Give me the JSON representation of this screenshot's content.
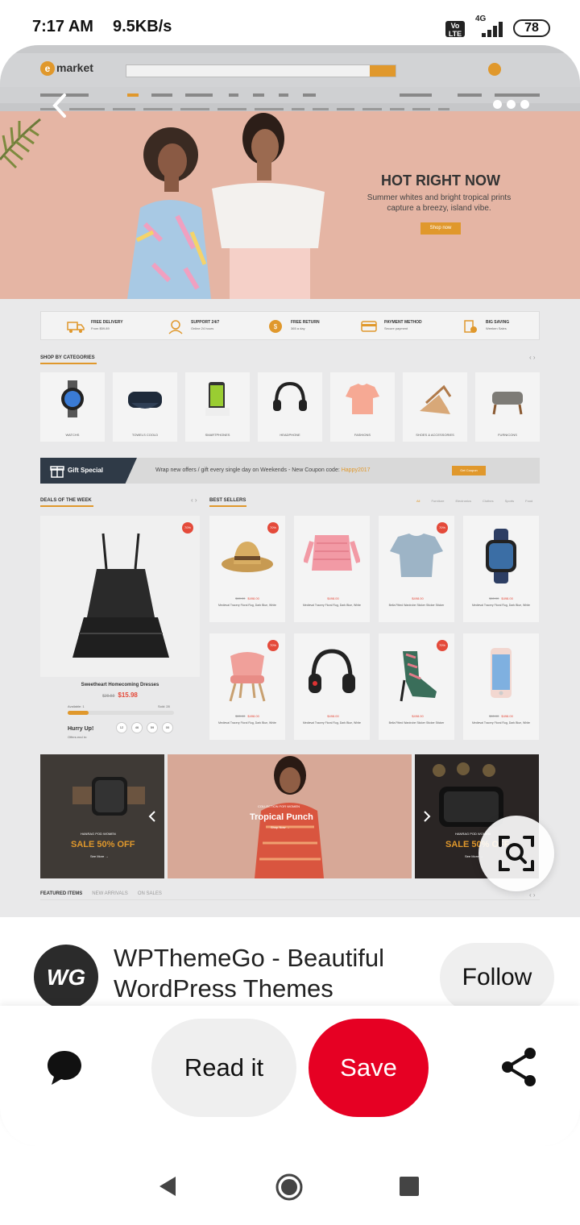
{
  "status_bar": {
    "time": "7:17 AM",
    "speed": "9.5KB/s",
    "volte": "Vo LTE",
    "network": "4G",
    "battery": "78"
  },
  "pin_image": {
    "site": {
      "logo": "market",
      "search_placeholder": "All Categories",
      "hero": {
        "title": "HOT RIGHT NOW",
        "subtitle": "Summer whites and bright tropical prints capture a breezy, island vibe.",
        "button": "Shop now"
      },
      "features": [
        {
          "title": "FREE DELIVERY",
          "sub": "From $59.89",
          "icon": "truck-icon"
        },
        {
          "title": "SUPPORT 24/7",
          "sub": "Online 24 hours",
          "icon": "support-icon"
        },
        {
          "title": "FREE RETURN",
          "sub": "365 a day",
          "icon": "return-icon"
        },
        {
          "title": "PAYMENT METHOD",
          "sub": "Secure payment",
          "icon": "payment-icon"
        },
        {
          "title": "BIG SAVING",
          "sub": "Weeken Sales",
          "icon": "saving-icon"
        }
      ],
      "categories_title": "SHOP BY CATEGORIES",
      "categories": [
        "WATCHS",
        "TOWELS COOLD",
        "SMARTPHONES",
        "HEADPHONE",
        "FASHIONS",
        "SHOES & ACCESSORIES",
        "FURNICONS"
      ],
      "gift": {
        "label": "Gift Special",
        "text": "Wrap new offers / gift every single day on Weekends - New Coupon code: ",
        "code": "Happy2017",
        "button": "Get Coupon"
      },
      "deals": {
        "title": "DEALS OF THE WEEK",
        "badge": "70%",
        "product_name": "Sweetheart Homecoming Dresses",
        "old_price": "$29.59",
        "price": "$15.98",
        "available_label": "Available: 1",
        "sold_label": "Sold: 28",
        "sold_fraction": 0.2,
        "hurry": "Hurry Up!",
        "offers_end": "Offers end in:",
        "countdown": [
          "12",
          "46",
          "59",
          "00"
        ]
      },
      "best_sellers": {
        "title": "BEST SELLERS",
        "tabs": [
          "All",
          "Furniture",
          "Electronics",
          "Clothes",
          "Sports",
          "Food"
        ],
        "products": [
          {
            "old": "$60.00",
            "price": "$498.00",
            "name": "Medieval Tracery Floral Rug, Dark Blue, White",
            "badge": "70%"
          },
          {
            "old": "",
            "price": "$498.00",
            "name": "Medieval Tracery Floral Rug, Dark Blue, White",
            "badge": "70%"
          },
          {
            "old": "",
            "price": "$498.00",
            "name": "Bella Fitted Wardrobe Sticker Sticker Sticker",
            "badge": "70%"
          },
          {
            "old": "$60.00",
            "price": "$498.00",
            "name": "Medieval Tracery Floral Rug, Dark Blue, White",
            "badge": ""
          },
          {
            "old": "$60.00",
            "price": "$498.00",
            "name": "Medieval Tracery Floral Rug, Dark Blue, White",
            "badge": "70%"
          },
          {
            "old": "",
            "price": "$498.00",
            "name": "Medieval Tracery Floral Rug, Dark Blue, White",
            "badge": ""
          },
          {
            "old": "",
            "price": "$498.00",
            "name": "Bella Fitted Wardrobe Sticker Sticker Sticker",
            "badge": "70%"
          },
          {
            "old": "$60.00",
            "price": "$498.00",
            "name": "Medieval Tracery Floral Rug, Dark Blue, White",
            "badge": ""
          }
        ]
      },
      "banners": [
        {
          "small": "HANRAG POD WOMEN",
          "big": "SALE 50% OFF",
          "more": "See More →"
        },
        {
          "small": "COLLECTION FOR WOMEN",
          "title": "Tropical Punch",
          "more": "Shop Now →"
        },
        {
          "small": "HANRAG POD WOMEN",
          "big": "SALE 50% OFF",
          "more": "See More →"
        }
      ],
      "featured_tabs": [
        "FEATURED ITEMS",
        "NEW ARRIVALS",
        "ON SALES"
      ]
    }
  },
  "creator": {
    "avatar_text": "WG",
    "name": "WPThemeGo - Beautiful WordPress Themes",
    "follow": "Follow"
  },
  "actions": {
    "read": "Read it",
    "save": "Save"
  },
  "colors": {
    "save": "#e60023",
    "accent": "#e0982c",
    "badge": "#e44a3a"
  }
}
